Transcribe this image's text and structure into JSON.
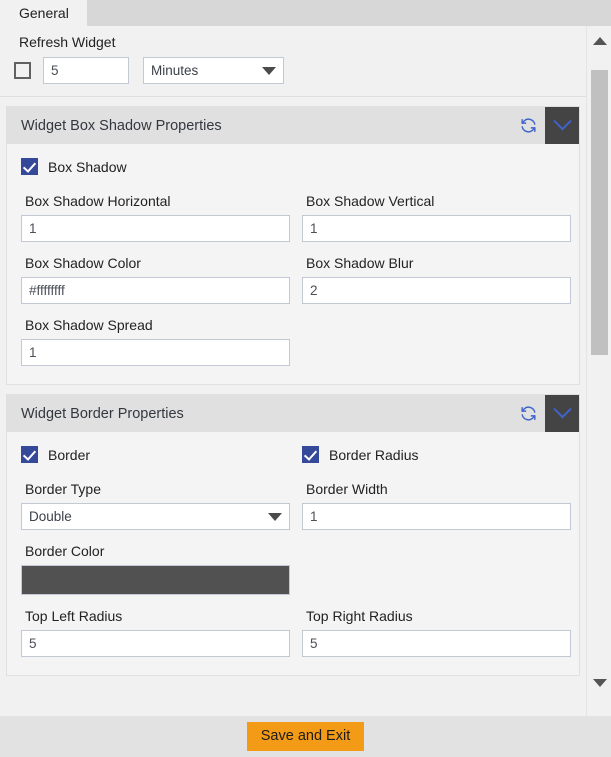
{
  "tabs": [
    {
      "label": "General",
      "active": true
    }
  ],
  "general": {
    "refresh_widget_label": "Refresh Widget",
    "refresh_enabled": false,
    "refresh_value": "5",
    "refresh_unit": "Minutes",
    "refresh_unit_options": [
      "Minutes"
    ]
  },
  "box_shadow_section": {
    "title": "Widget Box Shadow Properties",
    "refresh_icon": "refresh-icon",
    "collapse_icon": "chevron-down-icon",
    "checkbox_label": "Box Shadow",
    "checkbox_checked": true,
    "fields": {
      "horizontal_label": "Box Shadow Horizontal",
      "horizontal_value": "1",
      "vertical_label": "Box Shadow Vertical",
      "vertical_value": "1",
      "color_label": "Box Shadow Color",
      "color_value": "#ffffffff",
      "blur_label": "Box Shadow Blur",
      "blur_value": "2",
      "spread_label": "Box Shadow Spread",
      "spread_value": "1"
    }
  },
  "border_section": {
    "title": "Widget Border Properties",
    "refresh_icon": "refresh-icon",
    "collapse_icon": "chevron-down-icon",
    "border_checkbox_label": "Border",
    "border_checked": true,
    "border_radius_checkbox_label": "Border Radius",
    "border_radius_checked": true,
    "fields": {
      "type_label": "Border Type",
      "type_value": "Double",
      "type_options": [
        "Double"
      ],
      "width_label": "Border Width",
      "width_value": "1",
      "color_label": "Border Color",
      "color_swatch": "#515151",
      "top_left_radius_label": "Top Left Radius",
      "top_left_radius_value": "5",
      "top_right_radius_label": "Top Right Radius",
      "top_right_radius_value": "5"
    }
  },
  "scrollbar": {
    "up_icon": "triangle-up-icon",
    "down_icon": "triangle-down-icon"
  },
  "footer": {
    "save_label": "Save and Exit"
  },
  "colors": {
    "accent_orange": "#f39a16",
    "checkbox_blue": "#34499a",
    "icon_blue": "#3f63c9",
    "swatch_gray": "#515151",
    "header_gray": "#e0e0e0",
    "collapse_btn_gray": "#444444"
  }
}
